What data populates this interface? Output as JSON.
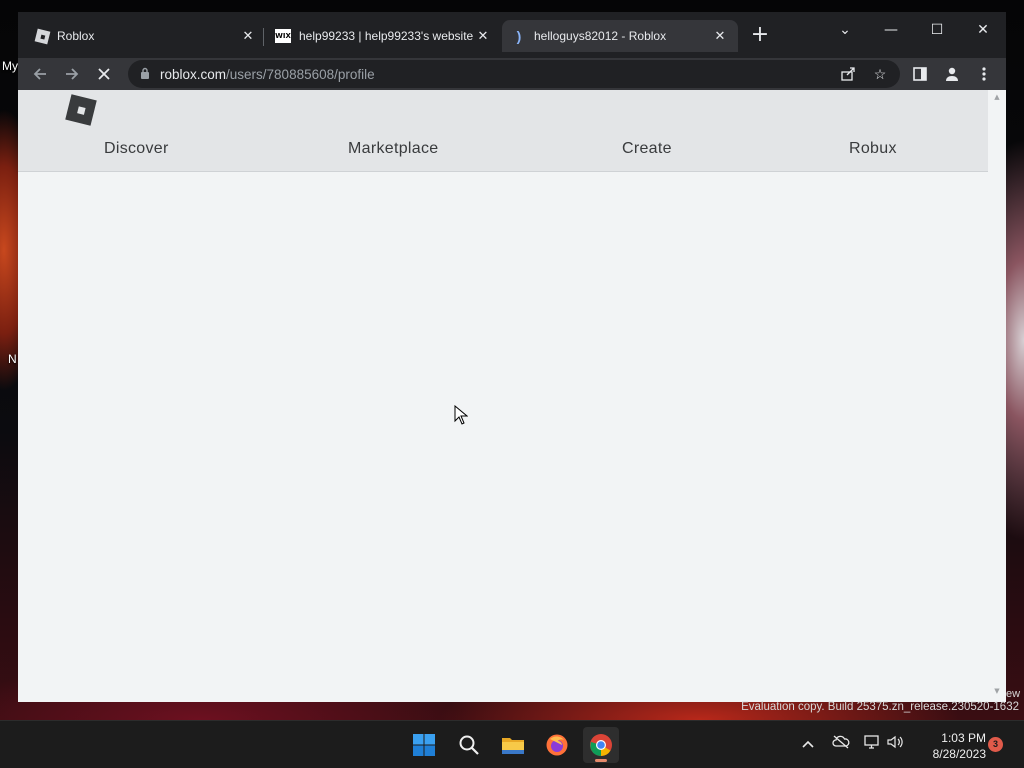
{
  "desktop": {
    "labels": [
      "My",
      "N"
    ]
  },
  "browser": {
    "tabs": [
      {
        "title": "Roblox",
        "favicon": "roblox-icon",
        "active": false
      },
      {
        "title": "help99233 | help99233's website",
        "favicon": "wix-icon",
        "favicon_text": "WIX",
        "active": false
      },
      {
        "title": "helloguys82012 - Roblox",
        "favicon": "loading-icon",
        "active": true
      }
    ],
    "tab_close_glyph": "✕",
    "new_tab_glyph": "+",
    "window_controls": {
      "tab_search": "⌄",
      "minimize": "—",
      "maximize": "☐",
      "close": "✕"
    },
    "address_bar": {
      "host": "roblox.com",
      "path": "/users/780885608/profile",
      "loading": true
    }
  },
  "page": {
    "nav": {
      "discover": "Discover",
      "marketplace": "Marketplace",
      "create": "Create",
      "robux": "Robux"
    }
  },
  "watermark": {
    "text": "Evaluation copy. Build 25375.zn_release.230520-1632",
    "cut_text": "ew"
  },
  "taskbar": {
    "apps": [
      "start-icon",
      "search-icon",
      "file-explorer-icon",
      "firefox-icon",
      "chrome-icon"
    ],
    "active_app": "chrome-icon",
    "clock": {
      "time": "1:03 PM",
      "date": "8/28/2023"
    },
    "notification_count": "3"
  },
  "colors": {
    "chrome_frame": "#202124",
    "chrome_toolbar": "#35363a",
    "roblox_header": "#e3e5e7",
    "page_background": "#f2f4f5",
    "taskbar": "#1c1c1c"
  }
}
